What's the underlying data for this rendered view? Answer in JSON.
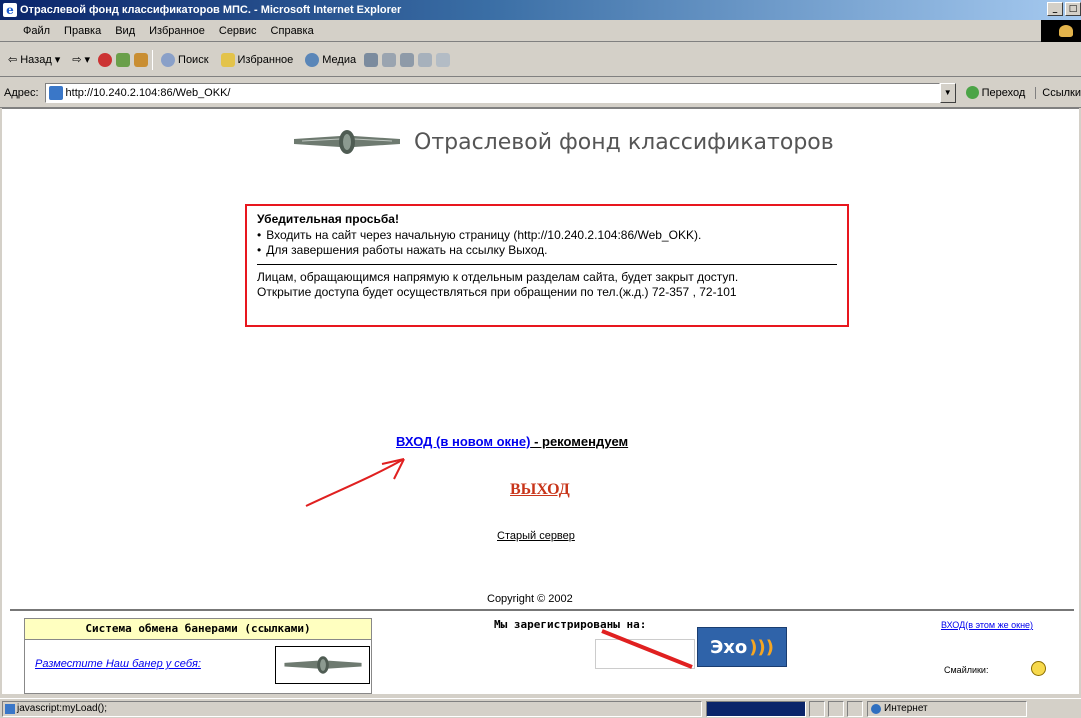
{
  "window": {
    "title": "Отраслевой фонд классификаторов МПС. - Microsoft Internet Explorer",
    "controls": [
      "_",
      "□"
    ]
  },
  "menu": [
    "Файл",
    "Правка",
    "Вид",
    "Избранное",
    "Сервис",
    "Справка"
  ],
  "toolbar": {
    "back": "Назад",
    "search": "Поиск",
    "favorites": "Избранное",
    "media": "Медиа"
  },
  "address": {
    "label": "Адрес:",
    "url": "http://10.240.2.104:86/Web_OKK/",
    "go": "Переход",
    "links": "Ссылки"
  },
  "page": {
    "title": "Отраслевой фонд классификаторов",
    "notice": {
      "heading": "Убедительная просьба!",
      "items": [
        "Входить на сайт через начальную страницу (http://10.240.2.104:86/Web_OKK).",
        "Для завершения работы нажать на ссылку Выход."
      ],
      "text1": "Лицам, обращающимся напрямую к отдельным разделам сайта, будет закрыт доступ.",
      "text2": "Открытие доступа будет осуществляться при обращении по тел.(ж.д.) 72-357 , 72-101"
    },
    "login_link": "ВХОД (в новом окне)",
    "login_recommend": " - рекомендуем",
    "logout_link": "ВЫХОД",
    "old_server": "Старый сервер",
    "copyright": "Copyright © 2002",
    "banner_exchange_title": "Система обмена банерами (ссылками)",
    "banner_place_link": "Разместите Наш банер у себя:",
    "registered_on": "Мы зарегистрированы на:",
    "echo_banner": "Эхо",
    "login_here": "ВХОД(в этом же окне)",
    "counter_label": "Смайлики:"
  },
  "status": {
    "text": "javascript:myLoad();",
    "zone": "Интернет",
    "progress": 1.0
  },
  "colors": {
    "notice_border": "#e8171e",
    "logout": "#c8351a",
    "link": "#0000ee",
    "annotation_arrow": "#e02020"
  }
}
